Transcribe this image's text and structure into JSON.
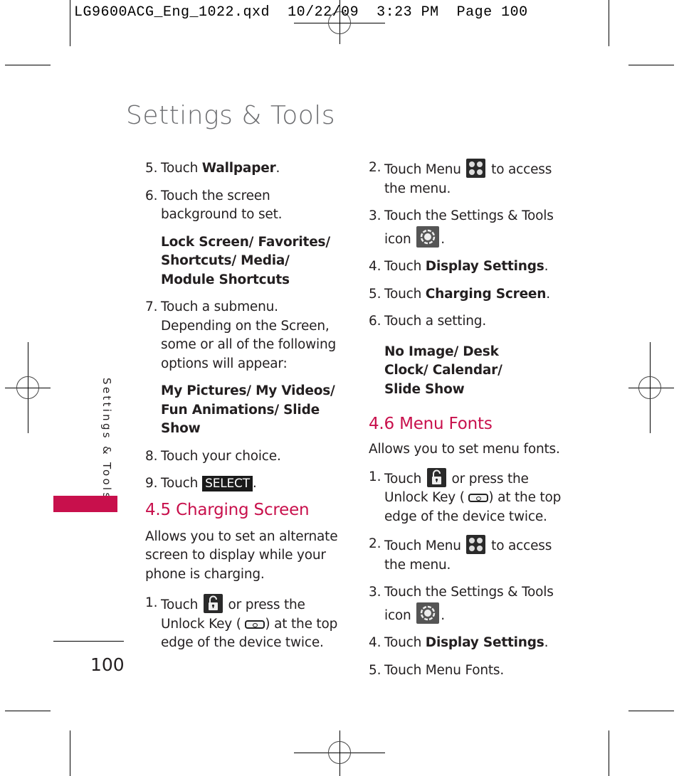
{
  "slug": {
    "file": "LG9600ACG_Eng_1022.qxd",
    "date": "10/22/09",
    "time": "3:23 PM",
    "page": "Page 100"
  },
  "title": "Settings & Tools",
  "side_tab": "Settings & Tools",
  "page_number": "100",
  "left_column": {
    "step5": {
      "num": "5.",
      "pre": "Touch ",
      "bold": "Wallpaper",
      "post": "."
    },
    "step6": {
      "num": "6.",
      "text": "Touch the screen background to set."
    },
    "options1": "Lock Screen/ Favorites/ Shortcuts/ Media/ Module Shortcuts",
    "step7": {
      "num": "7.",
      "text": "Touch a submenu. Depending on the Screen, some or all of the following options will appear:"
    },
    "options2": "My Pictures/ My Videos/ Fun Animations/ Slide Show",
    "step8": {
      "num": "8.",
      "text": "Touch your choice."
    },
    "step9": {
      "num": "9.",
      "pre": "Touch",
      "badge": "SELECT",
      "post": "."
    },
    "section": "4.5 Charging Screen",
    "section_desc": "Allows you to set an alternate screen to display while your phone is charging.",
    "step1": {
      "num": "1.",
      "pre": "Touch",
      "mid": "or press the Unlock Key (",
      "post": ") at the top edge of the device twice."
    }
  },
  "right_column": {
    "step2": {
      "num": "2.",
      "pre": "Touch Menu",
      "post": "to access the menu."
    },
    "step3": {
      "num": "3.",
      "pre": "Touch the Settings & Tools icon",
      "post": "."
    },
    "step4": {
      "num": "4.",
      "pre": "Touch ",
      "bold": "Display Settings",
      "post": "."
    },
    "step5": {
      "num": "5.",
      "pre": "Touch ",
      "bold": "Charging Screen",
      "post": "."
    },
    "step6": {
      "num": "6.",
      "text": "Touch a setting."
    },
    "options": "No Image/ Desk Clock/ Calendar/ Slide Show",
    "section": "4.6 Menu Fonts",
    "section_desc": "Allows you to set menu fonts.",
    "mf_step1": {
      "num": "1.",
      "pre": "Touch",
      "mid": "or press the Unlock Key (",
      "post": ") at the top edge of the device twice."
    },
    "mf_step2": {
      "num": "2.",
      "pre": "Touch Menu",
      "post": "to access the menu."
    },
    "mf_step3": {
      "num": "3.",
      "pre": "Touch the Settings & Tools icon",
      "post": "."
    },
    "mf_step4": {
      "num": "4.",
      "pre": "Touch ",
      "bold": "Display Settings",
      "post": "."
    },
    "mf_step5": {
      "num": "5.",
      "text": "Touch Menu Fonts."
    }
  },
  "colors": {
    "accent": "#c8104c",
    "title_gray": "#6d6e71"
  }
}
